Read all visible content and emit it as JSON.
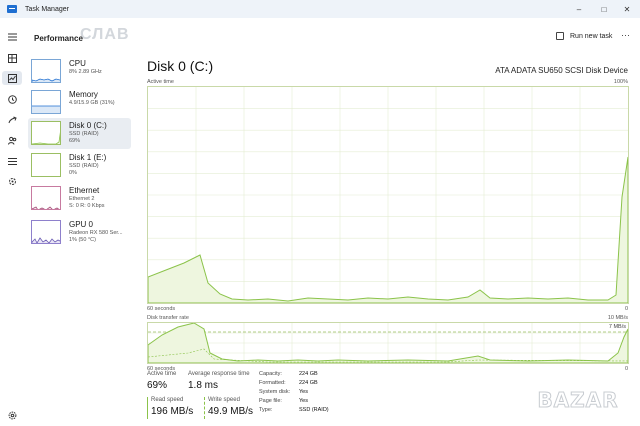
{
  "window": {
    "title": "Task Manager",
    "controls": [
      "–",
      "□",
      "✕"
    ]
  },
  "header": {
    "page": "Performance",
    "watermark": "СЛАВ",
    "run_new_task": "Run new task",
    "more": "···"
  },
  "rail": {
    "icons": [
      "menu-icon",
      "processes-icon",
      "performance-icon",
      "app-history-icon",
      "startup-icon",
      "users-icon",
      "details-icon",
      "services-icon",
      "settings-icon"
    ]
  },
  "sidebar": {
    "items": [
      {
        "name": "CPU",
        "sub1": "8%  2.89 GHz",
        "sub2": ""
      },
      {
        "name": "Memory",
        "sub1": "4.9/15.9 GB (31%)",
        "sub2": ""
      },
      {
        "name": "Disk 0 (C:)",
        "sub1": "SSD (RAID)",
        "sub2": "69%"
      },
      {
        "name": "Disk 1 (E:)",
        "sub1": "SSD (RAID)",
        "sub2": "0%"
      },
      {
        "name": "Ethernet",
        "sub1": "Ethernet 2",
        "sub2": "S: 0  R: 0 Kbps"
      },
      {
        "name": "GPU 0",
        "sub1": "Radeon RX 580 Ser...",
        "sub2": "1% (50 °C)"
      }
    ]
  },
  "main": {
    "title": "Disk 0 (C:)",
    "model": "ATA ADATA SU650 SCSI Disk Device",
    "active_time_label": "Active time",
    "active_max": "100%",
    "time_left": "60 seconds",
    "time_right": "0",
    "transfer_label": "Disk transfer rate",
    "transfer_max": "10 MB/s",
    "transfer_mark": "7 MB/s",
    "time_left2": "60 seconds",
    "time_right2": "0"
  },
  "stats": {
    "active_time": {
      "label": "Active time",
      "value": "69%"
    },
    "avg_response": {
      "label": "Average response time",
      "value": "1.8 ms"
    },
    "read_speed": {
      "label": "Read speed",
      "value": "196 MB/s"
    },
    "write_speed": {
      "label": "Write speed",
      "value": "49.9 MB/s"
    },
    "properties": [
      {
        "k": "Capacity:",
        "v": "224 GB"
      },
      {
        "k": "Formatted:",
        "v": "224 GB"
      },
      {
        "k": "System disk:",
        "v": "Yes"
      },
      {
        "k": "Page file:",
        "v": "Yes"
      },
      {
        "k": "Type:",
        "v": "SSD (RAID)"
      }
    ]
  },
  "watermark": {
    "logo": "BAZAR"
  },
  "colors": {
    "disk_line": "#8bc34a",
    "disk_fill": "#eef6df",
    "disk_border": "#c9d9a8",
    "cpu_thumb": "#1f6fd1",
    "eth_thumb": "#a34a74",
    "gpu_thumb": "#6b5cb3"
  }
}
